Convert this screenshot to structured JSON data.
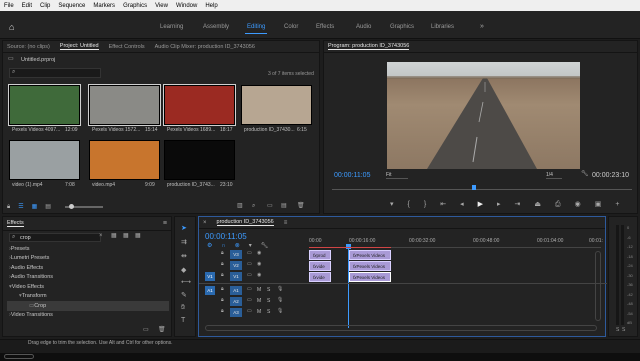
{
  "menu": [
    "File",
    "Edit",
    "Clip",
    "Sequence",
    "Markers",
    "Graphics",
    "View",
    "Window",
    "Help"
  ],
  "workspaces": [
    "Learning",
    "Assembly",
    "Editing",
    "Color",
    "Effects",
    "Audio",
    "Graphics",
    "Libraries"
  ],
  "project": {
    "tabs": [
      "Source: (no clips)",
      "Project: Untitled",
      "Effect Controls",
      "Audio Clip Mixer: production ID_3743056"
    ],
    "file": "Untitled.prproj",
    "count": "3 of 7 items selected",
    "items": [
      {
        "label": "Pexels Videos 4097...",
        "dur": "12:09",
        "color": "#3f6a3a"
      },
      {
        "label": "Pexels Videos 1572...",
        "dur": "15:14",
        "color": "#8a8a86"
      },
      {
        "label": "Pexels Videos 1689...",
        "dur": "18:17",
        "color": "#9b2a22"
      },
      {
        "label": "production ID_37430...",
        "dur": "6:15",
        "color": "#b7a692"
      },
      {
        "label": "video (1).mp4",
        "dur": "7:08",
        "color": "#9aa0a2"
      },
      {
        "label": "video.mp4",
        "dur": "9:09",
        "color": "#c8752d"
      },
      {
        "label": "production ID_3743...",
        "dur": "23:10",
        "color": "#0a0a0a"
      }
    ]
  },
  "program": {
    "title": "Program: production ID_3743056",
    "timecode": "00:00:11:05",
    "fit": "Fit",
    "quality": "1/4",
    "duration": "00:00:23:10"
  },
  "effects": {
    "title": "Effects",
    "search": "crop",
    "tree": [
      {
        "label": "Presets",
        "indent": 0
      },
      {
        "label": "Lumetri Presets",
        "indent": 0
      },
      {
        "label": "Audio Effects",
        "indent": 0
      },
      {
        "label": "Audio Transitions",
        "indent": 0
      },
      {
        "label": "Video Effects",
        "indent": 0
      },
      {
        "label": "Transform",
        "indent": 1
      },
      {
        "label": "Crop",
        "indent": 2
      },
      {
        "label": "Video Transitions",
        "indent": 0
      }
    ]
  },
  "timeline": {
    "title": "production ID_3743056",
    "timecode": "00:00:11:05",
    "ruler": [
      "00:00",
      "00:00:16:00",
      "00:00:32:00",
      "00:00:48:00",
      "00:01:04:00",
      "00:01:"
    ],
    "video_tracks": [
      "V3",
      "V2",
      "V1"
    ],
    "audio_tracks": [
      "A1",
      "A2",
      "A3"
    ],
    "source_patch": [
      "V1",
      "A1"
    ],
    "clips": [
      {
        "track": "V3",
        "label": "prod",
        "col": 0
      },
      {
        "track": "V2",
        "label": "vide",
        "col": 0
      },
      {
        "track": "V1",
        "label": "vide",
        "col": 0
      },
      {
        "track": "V3",
        "label": "Pexels Videos",
        "col": 1
      },
      {
        "track": "V2",
        "label": "Pexels Videos",
        "col": 1
      },
      {
        "track": "V1",
        "label": "Pexels Videos",
        "col": 1
      }
    ],
    "meter_labels": [
      "0",
      "-6",
      "-12",
      "-18",
      "-24",
      "-30",
      "-36",
      "-42",
      "-48",
      "-54",
      "dB"
    ]
  },
  "status": "Drag edge to trim the selection. Use Alt and Ctrl for other options."
}
